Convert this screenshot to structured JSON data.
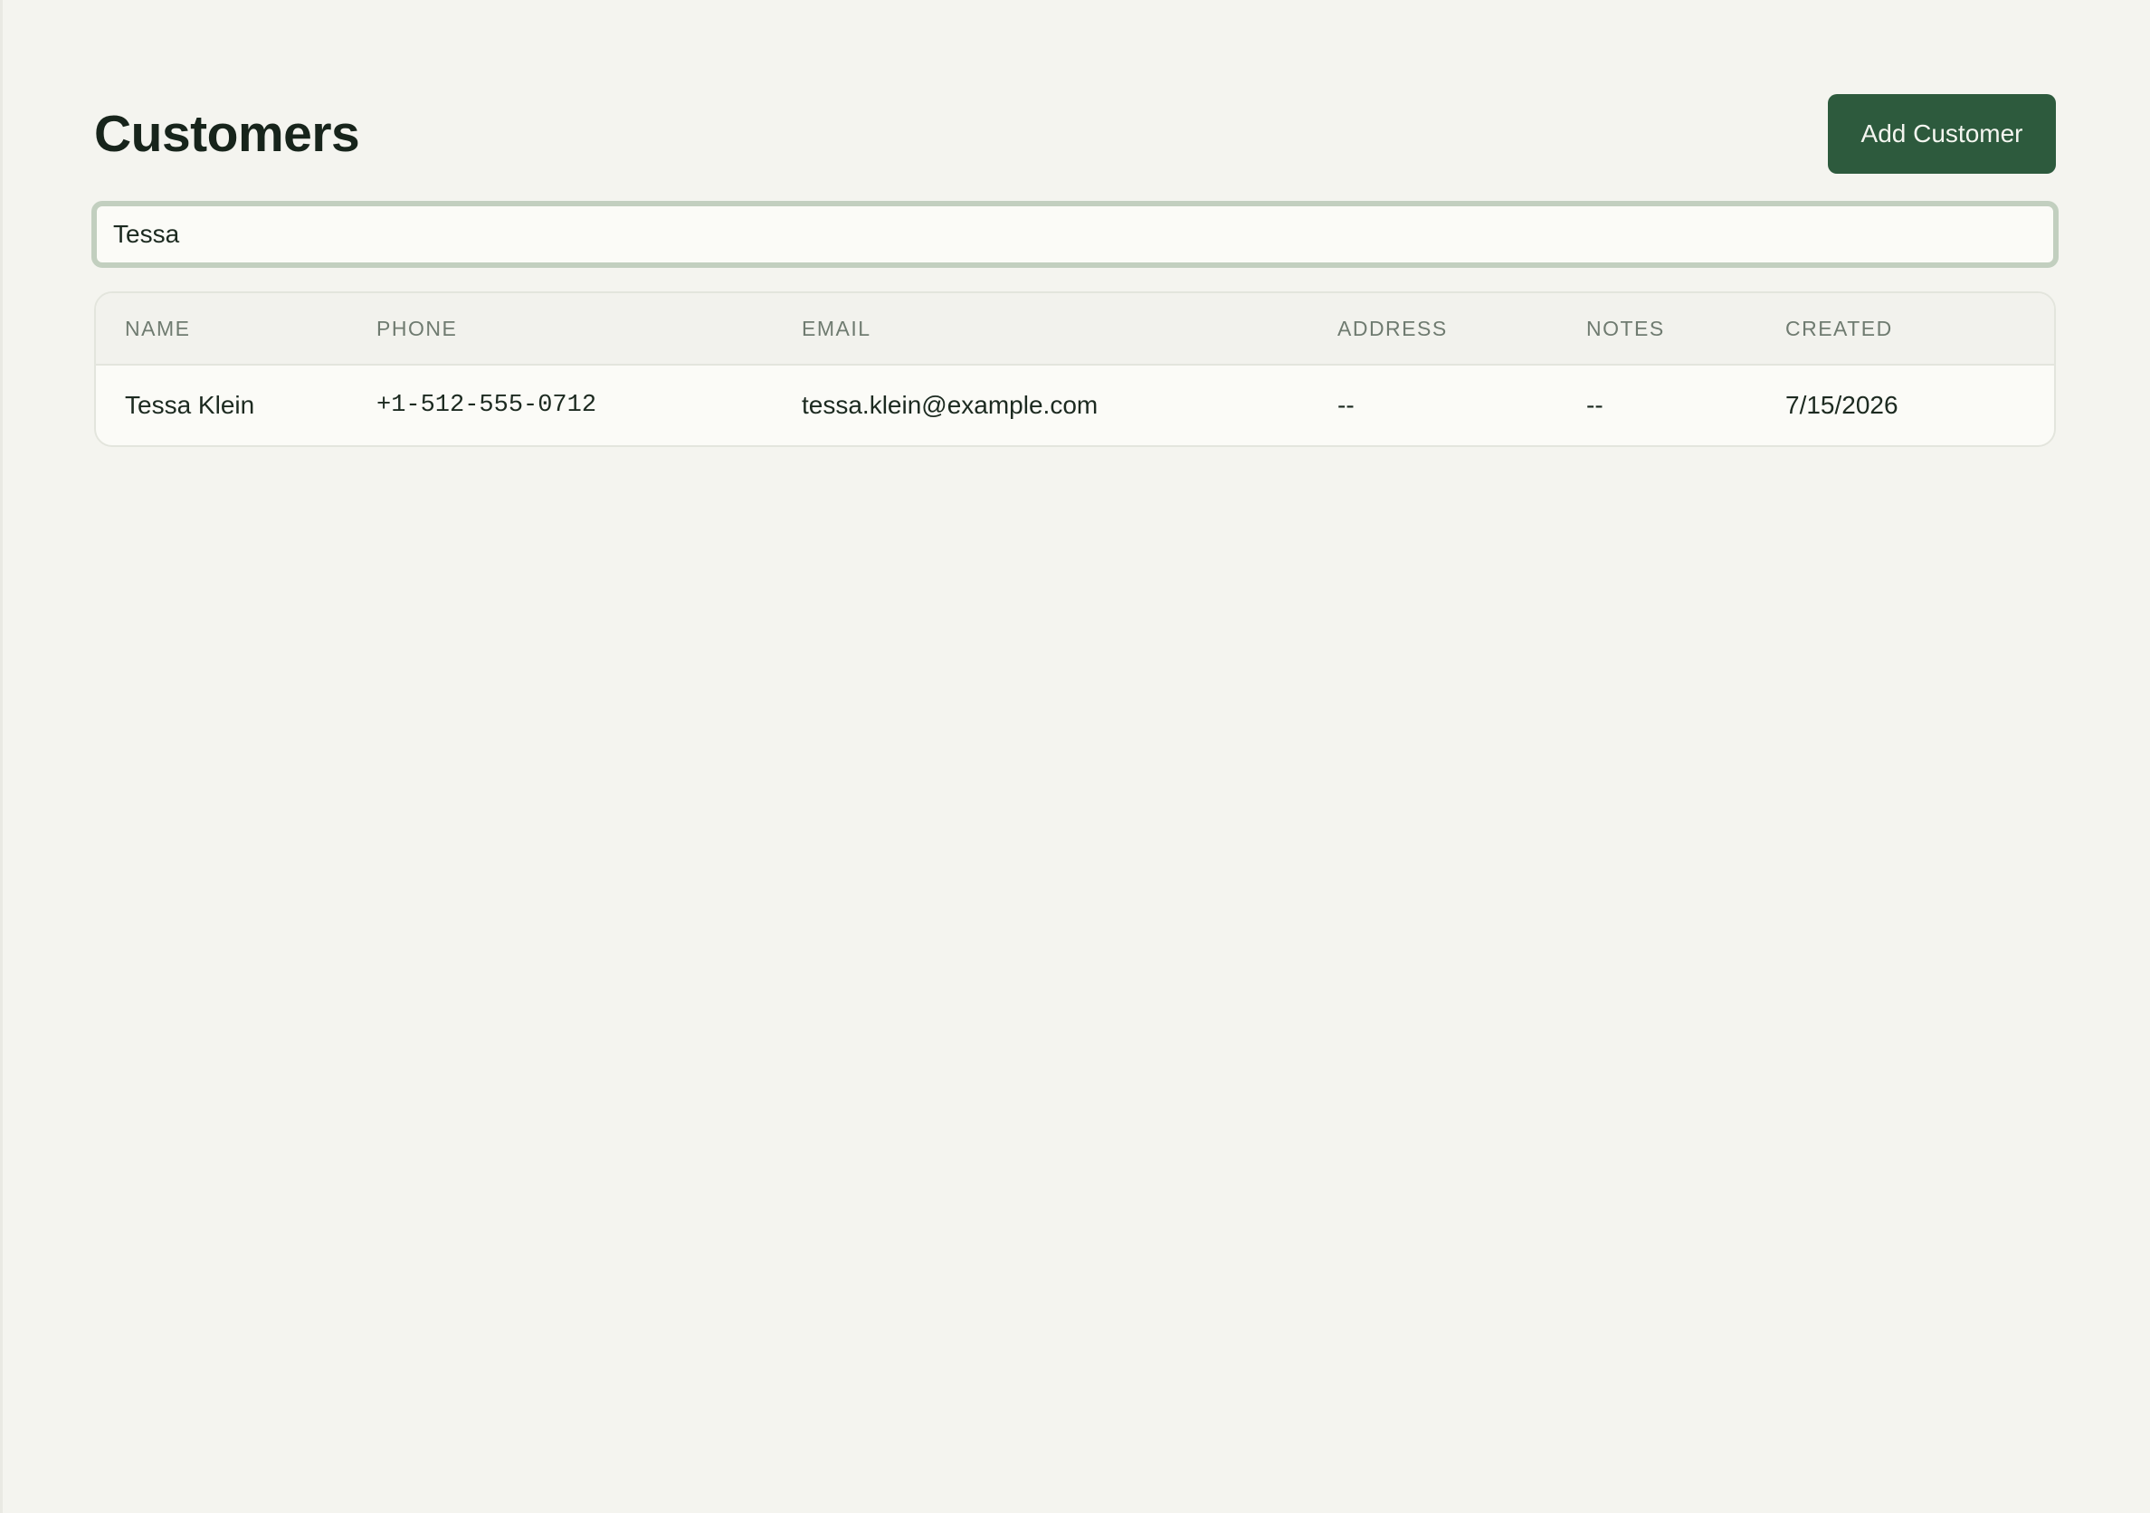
{
  "page": {
    "title": "Customers",
    "add_button_label": "Add Customer"
  },
  "search": {
    "value": "Tessa"
  },
  "table": {
    "columns": [
      "NAME",
      "PHONE",
      "EMAIL",
      "ADDRESS",
      "NOTES",
      "CREATED"
    ],
    "rows": [
      {
        "name": "Tessa Klein",
        "phone": "+1-512-555-0712",
        "email": "tessa.klein@example.com",
        "address": "--",
        "notes": "--",
        "created": "7/15/2026"
      }
    ]
  },
  "colors": {
    "accent": "#2d5a3d",
    "background": "#f4f4ef",
    "search_border": "#c2cfbf"
  }
}
